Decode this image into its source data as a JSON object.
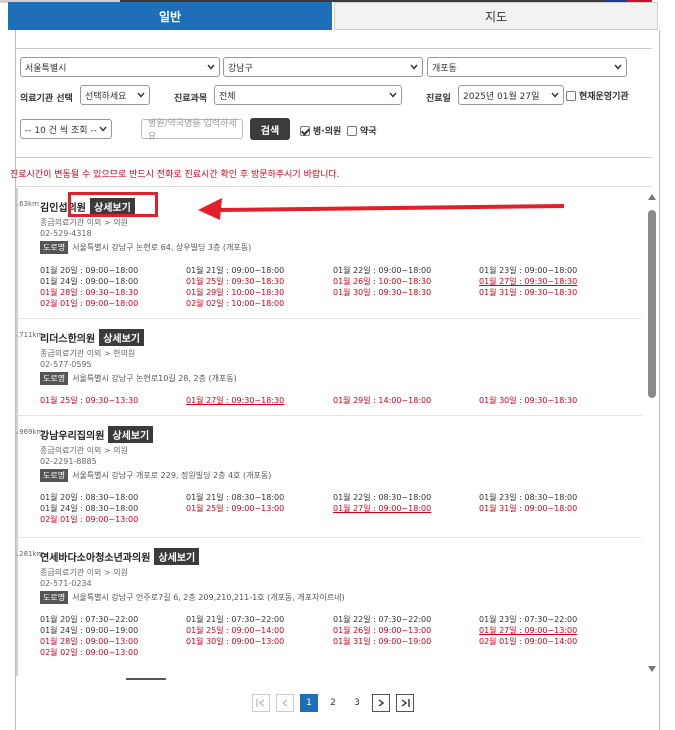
{
  "tabs": [
    {
      "label": "일반",
      "active": true
    },
    {
      "label": "지도",
      "active": false
    }
  ],
  "filters": {
    "city": "서울특별시",
    "district": "강남구",
    "dong": "개포동",
    "institution_label": "의료기관 선택",
    "institution_value": "선택하세요",
    "department_label": "진료과목",
    "department_value": "전체",
    "date_label": "진료일",
    "date_value": "2025년 01월 27일",
    "operating_label": "현재운영기관",
    "per_page": "-- 10 건 씩 조회 --",
    "search_placeholder": "병원/약국명을 입력하세요",
    "search_button": "검색",
    "hospital_clinic_label": "병·의원",
    "pharmacy_label": "약국"
  },
  "notice": "진료시간이 변동될 수 있으므로 반드시 전화로 진료시간 확인 후 방문하주시기 바랍니다.",
  "detail_label": "상세보기",
  "road_label": "도로명",
  "clinics": [
    {
      "distance": "14.63km",
      "name": "김인섭의원",
      "category": "종급의료기관 이외 > 의원",
      "phone": "02-529-4318",
      "address": "서울특별시 강남구 논현로 64, 상우빌딩 3층 (개포동)",
      "hours": [
        [
          "01월 20일 : 09:00~18:00",
          "01월 21일 : 09:00~18:00",
          "01월 22일 : 09:00~18:00",
          "01월 23일 : 09:00~18:00"
        ],
        [
          "01월 24일 : 09:00~18:00",
          "01월 25일 : 09:30~18:30",
          "01월 26일 : 10:00~18:30",
          "01월 27일 : 09:30~18:30"
        ],
        [
          "01월 28일 : 09:30~18:30",
          "01월 29일 : 10:00~18:30",
          "01월 30일 : 09:30~18:30",
          "01월 31일 : 09:30~18:30"
        ],
        [
          "02월 01일 : 09:00~18:00",
          "02월 02일 : 10:00~18:00",
          "",
          ""
        ]
      ]
    },
    {
      "distance": "14.711km",
      "name": "리더스한의원",
      "category": "종급의료기관 이외 > 한의원",
      "phone": "02-577-0595",
      "address": "서울특별시 강남구 논현로10길 28, 2층 (개포동)",
      "hours": [
        [
          "01월 25일 : 09:30~13:30",
          "01월 27일 : 09:30~18:30",
          "01월 29일 : 14:00~18:00",
          "01월 30일 : 09:30~18:30"
        ]
      ]
    },
    {
      "distance": "14.969km",
      "name": "강남우리집의원",
      "category": "종급의료기관 이외 > 의원",
      "phone": "02-2291-8885",
      "address": "서울특별시 강남구 개포로 229, 정원빌딩 2층 4호 (개포동)",
      "hours": [
        [
          "01월 20일 : 08:30~18:00",
          "01월 21일 : 08:30~18:00",
          "01월 22일 : 08:30~18:00",
          "01월 23일 : 08:30~18:00"
        ],
        [
          "01월 24일 : 08:30~18:00",
          "01월 25일 : 09:00~13:00",
          "01월 27일 : 09:00~18:00",
          "01월 31일 : 09:00~18:00"
        ],
        [
          "02월 01일 : 09:00~13:00",
          "",
          "",
          ""
        ]
      ]
    },
    {
      "distance": "15.281km",
      "name": "연세바다소아청소년과의원",
      "category": "종급의료기관 이외 > 의원",
      "phone": "02-571-0234",
      "address": "서울특별시 강남구 언주로7길 6, 2층 209,210,211-1호 (개포동, 개포자이르네)",
      "hours": [
        [
          "01월 20일 : 07:30~22:00",
          "01월 21일 : 07:30~22:00",
          "01월 22일 : 07:30~22:00",
          "01월 23일 : 07:30~22:00"
        ],
        [
          "01월 24일 : 09:00~19:00",
          "01월 25일 : 09:00~14:00",
          "01월 26일 : 09:00~13:00",
          "01월 27일 : 09:00~13:00"
        ],
        [
          "01월 28일 : 09:00~13:00",
          "01월 30일 : 09:00~13:00",
          "01월 31일 : 09:00~19:00",
          "02월 01일 : 09:00~14:00"
        ],
        [
          "02월 02일 : 09:00~13:00",
          "",
          "",
          ""
        ]
      ]
    }
  ],
  "pagination": {
    "pages": [
      "1",
      "2",
      "3"
    ],
    "current": "1"
  }
}
